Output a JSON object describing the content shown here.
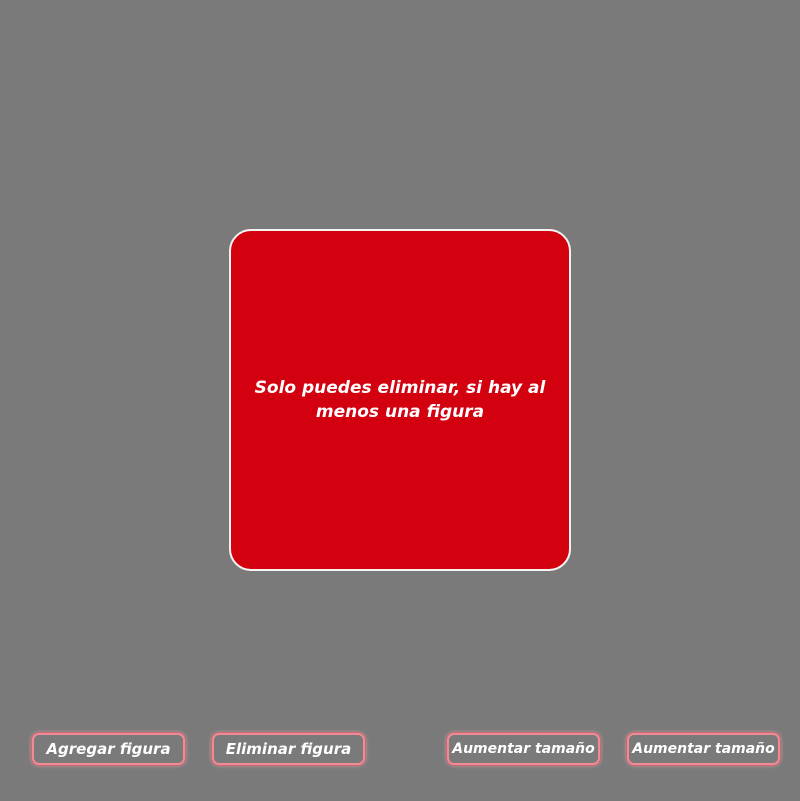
{
  "modal": {
    "message": "Solo puedes eliminar, si hay al menos una figura"
  },
  "buttons": {
    "add": "Agregar figura",
    "remove": "Eliminar figura",
    "grow_1": "Aumentar tamaño",
    "grow_2": "Aumentar tamaño"
  },
  "colors": {
    "background": "#7a7a7a",
    "modal_background": "#d3000f",
    "modal_border": "#f4f4f4",
    "button_border": "#f08a95",
    "text": "#ffffff"
  }
}
